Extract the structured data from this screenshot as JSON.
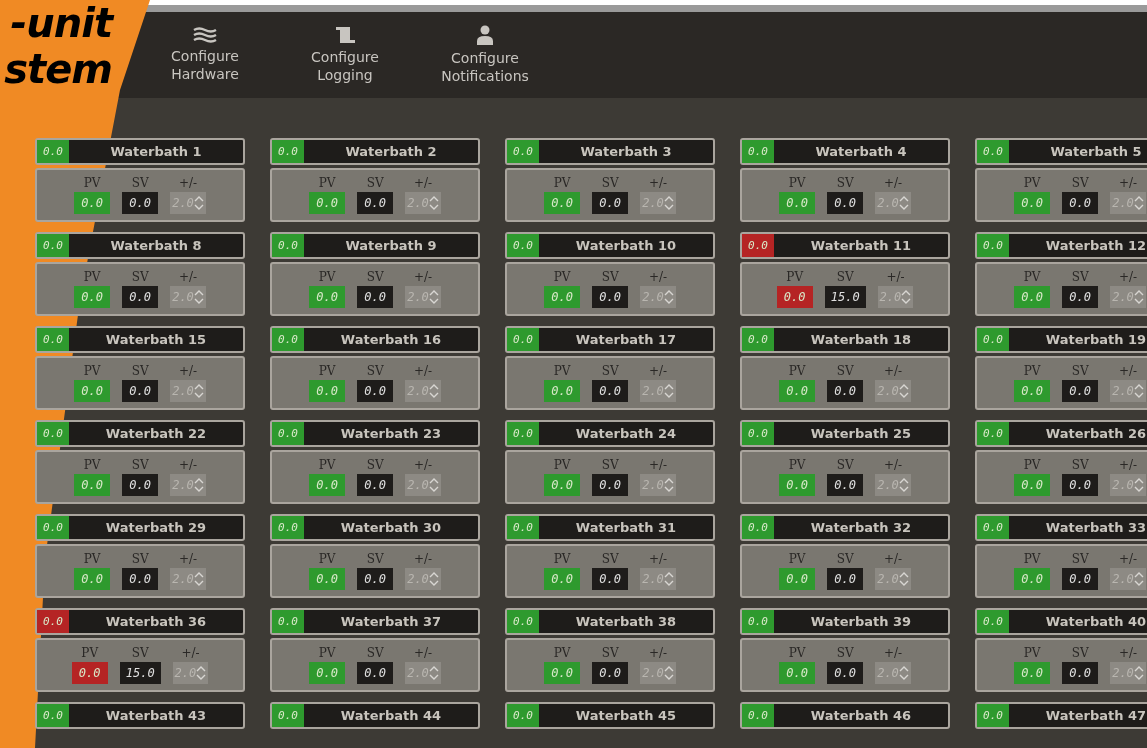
{
  "banner": {
    "lines": [
      "-unit",
      "stem"
    ]
  },
  "nav": [
    {
      "label": "Configure Hardware",
      "kind": "hardware"
    },
    {
      "label": "Configure Logging",
      "kind": "logging"
    },
    {
      "label": "Configure Notifications",
      "kind": "notifications"
    }
  ],
  "baths": [
    {
      "title": "Waterbath 1",
      "reading": "0.0",
      "pv_label": "PV",
      "pv": "0.0",
      "sv_label": "SV",
      "sv": "0.0",
      "tolerance_label": "+/-",
      "tolerance": "2.0",
      "alarm": false
    },
    {
      "title": "Waterbath 2",
      "reading": "0.0",
      "pv_label": "PV",
      "pv": "0.0",
      "sv_label": "SV",
      "sv": "0.0",
      "tolerance_label": "+/-",
      "tolerance": "2.0",
      "alarm": false
    },
    {
      "title": "Waterbath 3",
      "reading": "0.0",
      "pv_label": "PV",
      "pv": "0.0",
      "sv_label": "SV",
      "sv": "0.0",
      "tolerance_label": "+/-",
      "tolerance": "2.0",
      "alarm": false
    },
    {
      "title": "Waterbath 4",
      "reading": "0.0",
      "pv_label": "PV",
      "pv": "0.0",
      "sv_label": "SV",
      "sv": "0.0",
      "tolerance_label": "+/-",
      "tolerance": "2.0",
      "alarm": false
    },
    {
      "title": "Waterbath 5",
      "reading": "0.0",
      "pv_label": "PV",
      "pv": "0.0",
      "sv_label": "SV",
      "sv": "0.0",
      "tolerance_label": "+/-",
      "tolerance": "2.0",
      "alarm": false
    },
    {
      "title": "Waterbath 8",
      "reading": "0.0",
      "pv_label": "PV",
      "pv": "0.0",
      "sv_label": "SV",
      "sv": "0.0",
      "tolerance_label": "+/-",
      "tolerance": "2.0",
      "alarm": false
    },
    {
      "title": "Waterbath 9",
      "reading": "0.0",
      "pv_label": "PV",
      "pv": "0.0",
      "sv_label": "SV",
      "sv": "0.0",
      "tolerance_label": "+/-",
      "tolerance": "2.0",
      "alarm": false
    },
    {
      "title": "Waterbath 10",
      "reading": "0.0",
      "pv_label": "PV",
      "pv": "0.0",
      "sv_label": "SV",
      "sv": "0.0",
      "tolerance_label": "+/-",
      "tolerance": "2.0",
      "alarm": false
    },
    {
      "title": "Waterbath 11",
      "reading": "0.0",
      "pv_label": "PV",
      "pv": "0.0",
      "sv_label": "SV",
      "sv": "15.0",
      "tolerance_label": "+/-",
      "tolerance": "2.0",
      "alarm": true
    },
    {
      "title": "Waterbath 12",
      "reading": "0.0",
      "pv_label": "PV",
      "pv": "0.0",
      "sv_label": "SV",
      "sv": "0.0",
      "tolerance_label": "+/-",
      "tolerance": "2.0",
      "alarm": false
    },
    {
      "title": "Waterbath 15",
      "reading": "0.0",
      "pv_label": "PV",
      "pv": "0.0",
      "sv_label": "SV",
      "sv": "0.0",
      "tolerance_label": "+/-",
      "tolerance": "2.0",
      "alarm": false
    },
    {
      "title": "Waterbath 16",
      "reading": "0.0",
      "pv_label": "PV",
      "pv": "0.0",
      "sv_label": "SV",
      "sv": "0.0",
      "tolerance_label": "+/-",
      "tolerance": "2.0",
      "alarm": false
    },
    {
      "title": "Waterbath 17",
      "reading": "0.0",
      "pv_label": "PV",
      "pv": "0.0",
      "sv_label": "SV",
      "sv": "0.0",
      "tolerance_label": "+/-",
      "tolerance": "2.0",
      "alarm": false
    },
    {
      "title": "Waterbath 18",
      "reading": "0.0",
      "pv_label": "PV",
      "pv": "0.0",
      "sv_label": "SV",
      "sv": "0.0",
      "tolerance_label": "+/-",
      "tolerance": "2.0",
      "alarm": false
    },
    {
      "title": "Waterbath 19",
      "reading": "0.0",
      "pv_label": "PV",
      "pv": "0.0",
      "sv_label": "SV",
      "sv": "0.0",
      "tolerance_label": "+/-",
      "tolerance": "2.0",
      "alarm": false
    },
    {
      "title": "Waterbath 22",
      "reading": "0.0",
      "pv_label": "PV",
      "pv": "0.0",
      "sv_label": "SV",
      "sv": "0.0",
      "tolerance_label": "+/-",
      "tolerance": "2.0",
      "alarm": false
    },
    {
      "title": "Waterbath 23",
      "reading": "0.0",
      "pv_label": "PV",
      "pv": "0.0",
      "sv_label": "SV",
      "sv": "0.0",
      "tolerance_label": "+/-",
      "tolerance": "2.0",
      "alarm": false
    },
    {
      "title": "Waterbath 24",
      "reading": "0.0",
      "pv_label": "PV",
      "pv": "0.0",
      "sv_label": "SV",
      "sv": "0.0",
      "tolerance_label": "+/-",
      "tolerance": "2.0",
      "alarm": false
    },
    {
      "title": "Waterbath 25",
      "reading": "0.0",
      "pv_label": "PV",
      "pv": "0.0",
      "sv_label": "SV",
      "sv": "0.0",
      "tolerance_label": "+/-",
      "tolerance": "2.0",
      "alarm": false
    },
    {
      "title": "Waterbath 26",
      "reading": "0.0",
      "pv_label": "PV",
      "pv": "0.0",
      "sv_label": "SV",
      "sv": "0.0",
      "tolerance_label": "+/-",
      "tolerance": "2.0",
      "alarm": false
    },
    {
      "title": "Waterbath 29",
      "reading": "0.0",
      "pv_label": "PV",
      "pv": "0.0",
      "sv_label": "SV",
      "sv": "0.0",
      "tolerance_label": "+/-",
      "tolerance": "2.0",
      "alarm": false
    },
    {
      "title": "Waterbath 30",
      "reading": "0.0",
      "pv_label": "PV",
      "pv": "0.0",
      "sv_label": "SV",
      "sv": "0.0",
      "tolerance_label": "+/-",
      "tolerance": "2.0",
      "alarm": false
    },
    {
      "title": "Waterbath 31",
      "reading": "0.0",
      "pv_label": "PV",
      "pv": "0.0",
      "sv_label": "SV",
      "sv": "0.0",
      "tolerance_label": "+/-",
      "tolerance": "2.0",
      "alarm": false
    },
    {
      "title": "Waterbath 32",
      "reading": "0.0",
      "pv_label": "PV",
      "pv": "0.0",
      "sv_label": "SV",
      "sv": "0.0",
      "tolerance_label": "+/-",
      "tolerance": "2.0",
      "alarm": false
    },
    {
      "title": "Waterbath 33",
      "reading": "0.0",
      "pv_label": "PV",
      "pv": "0.0",
      "sv_label": "SV",
      "sv": "0.0",
      "tolerance_label": "+/-",
      "tolerance": "2.0",
      "alarm": false
    },
    {
      "title": "Waterbath 36",
      "reading": "0.0",
      "pv_label": "PV",
      "pv": "0.0",
      "sv_label": "SV",
      "sv": "15.0",
      "tolerance_label": "+/-",
      "tolerance": "2.0",
      "alarm": true
    },
    {
      "title": "Waterbath 37",
      "reading": "0.0",
      "pv_label": "PV",
      "pv": "0.0",
      "sv_label": "SV",
      "sv": "0.0",
      "tolerance_label": "+/-",
      "tolerance": "2.0",
      "alarm": false
    },
    {
      "title": "Waterbath 38",
      "reading": "0.0",
      "pv_label": "PV",
      "pv": "0.0",
      "sv_label": "SV",
      "sv": "0.0",
      "tolerance_label": "+/-",
      "tolerance": "2.0",
      "alarm": false
    },
    {
      "title": "Waterbath 39",
      "reading": "0.0",
      "pv_label": "PV",
      "pv": "0.0",
      "sv_label": "SV",
      "sv": "0.0",
      "tolerance_label": "+/-",
      "tolerance": "2.0",
      "alarm": false
    },
    {
      "title": "Waterbath 40",
      "reading": "0.0",
      "pv_label": "PV",
      "pv": "0.0",
      "sv_label": "SV",
      "sv": "0.0",
      "tolerance_label": "+/-",
      "tolerance": "2.0",
      "alarm": false
    },
    {
      "title": "Waterbath 43",
      "reading": "0.0",
      "alarm": false
    },
    {
      "title": "Waterbath 44",
      "reading": "0.0",
      "alarm": false
    },
    {
      "title": "Waterbath 45",
      "reading": "0.0",
      "alarm": false
    },
    {
      "title": "Waterbath 46",
      "reading": "0.0",
      "alarm": false
    },
    {
      "title": "Waterbath 47",
      "reading": "0.0",
      "alarm": false
    }
  ]
}
